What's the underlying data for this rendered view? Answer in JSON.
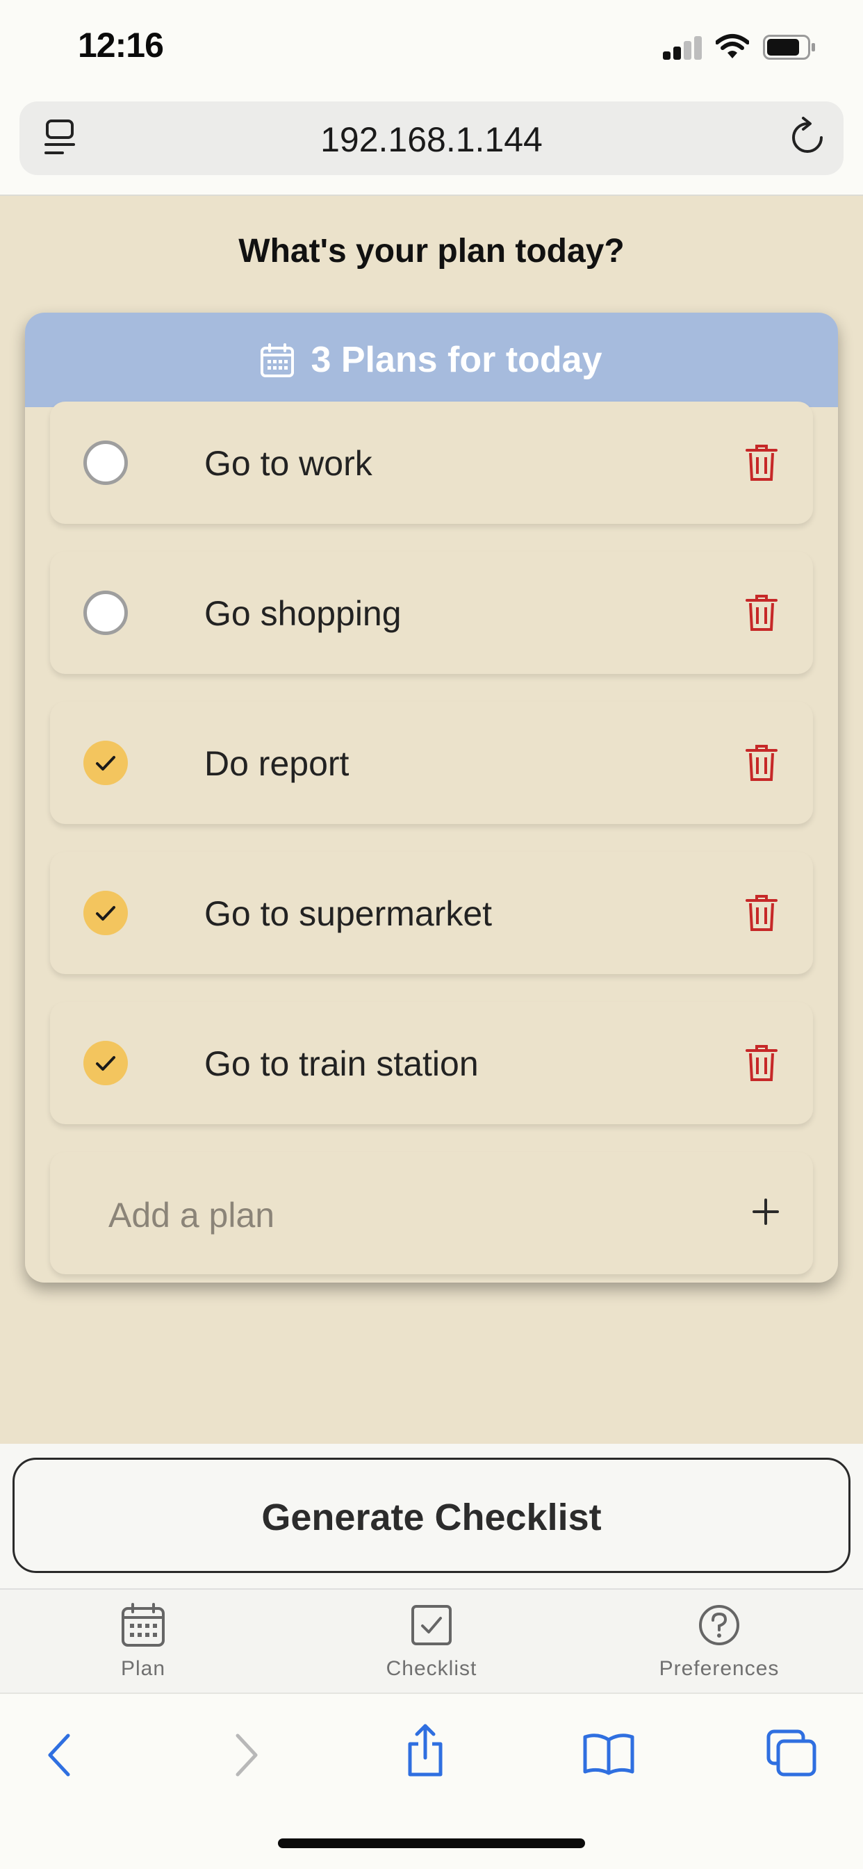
{
  "status_bar": {
    "time": "12:16"
  },
  "address_bar": {
    "url": "192.168.1.144"
  },
  "page": {
    "heading": "What's your plan today?"
  },
  "card": {
    "title": "3 Plans for today",
    "header_color": "#a6bbdd",
    "plans": [
      {
        "label": "Go to work",
        "done": false
      },
      {
        "label": "Go shopping",
        "done": false
      },
      {
        "label": "Do report",
        "done": true
      },
      {
        "label": "Go to supermarket",
        "done": true
      },
      {
        "label": "Go to train station",
        "done": true
      }
    ],
    "add_placeholder": "Add a plan"
  },
  "generate_button": {
    "label": "Generate Checklist"
  },
  "tabbar": {
    "items": [
      {
        "label": "Plan",
        "icon": "calendar-icon"
      },
      {
        "label": "Checklist",
        "icon": "checkbox-icon"
      },
      {
        "label": "Preferences",
        "icon": "question-icon"
      }
    ]
  },
  "colors": {
    "background": "#ebe2cb",
    "check": "#f3c55e",
    "trash": "#c62828"
  }
}
